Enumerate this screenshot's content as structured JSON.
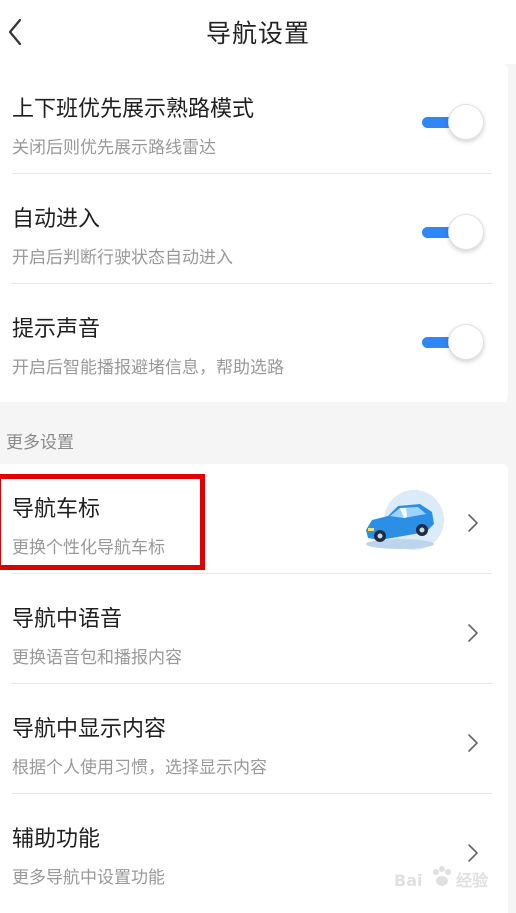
{
  "header": {
    "title": "导航设置",
    "back_icon": "chevron-left-icon"
  },
  "basic_settings": [
    {
      "label": "上下班优先展示熟路模式",
      "desc": "关闭后则优先展示路线雷达",
      "enabled": true
    },
    {
      "label": "自动进入",
      "desc": "开启后判断行驶状态自动进入",
      "enabled": true
    },
    {
      "label": "提示声音",
      "desc": "开启后智能播报避堵信息，帮助选路",
      "enabled": true
    }
  ],
  "more": {
    "section_title": "更多设置",
    "items": [
      {
        "label": "导航车标",
        "desc": "更换个性化导航车标",
        "icon": "blue-car-illustration"
      },
      {
        "label": "导航中语音",
        "desc": "更换语音包和播报内容"
      },
      {
        "label": "导航中显示内容",
        "desc": "根据个人使用习惯，选择显示内容"
      },
      {
        "label": "辅助功能",
        "desc": "更多导航中设置功能"
      }
    ]
  },
  "colors": {
    "accent": "#2f86f6",
    "highlight": "#e00000",
    "background": "#f5f5f5"
  },
  "watermark": {
    "brand": "Bai",
    "suffix": "经验"
  }
}
